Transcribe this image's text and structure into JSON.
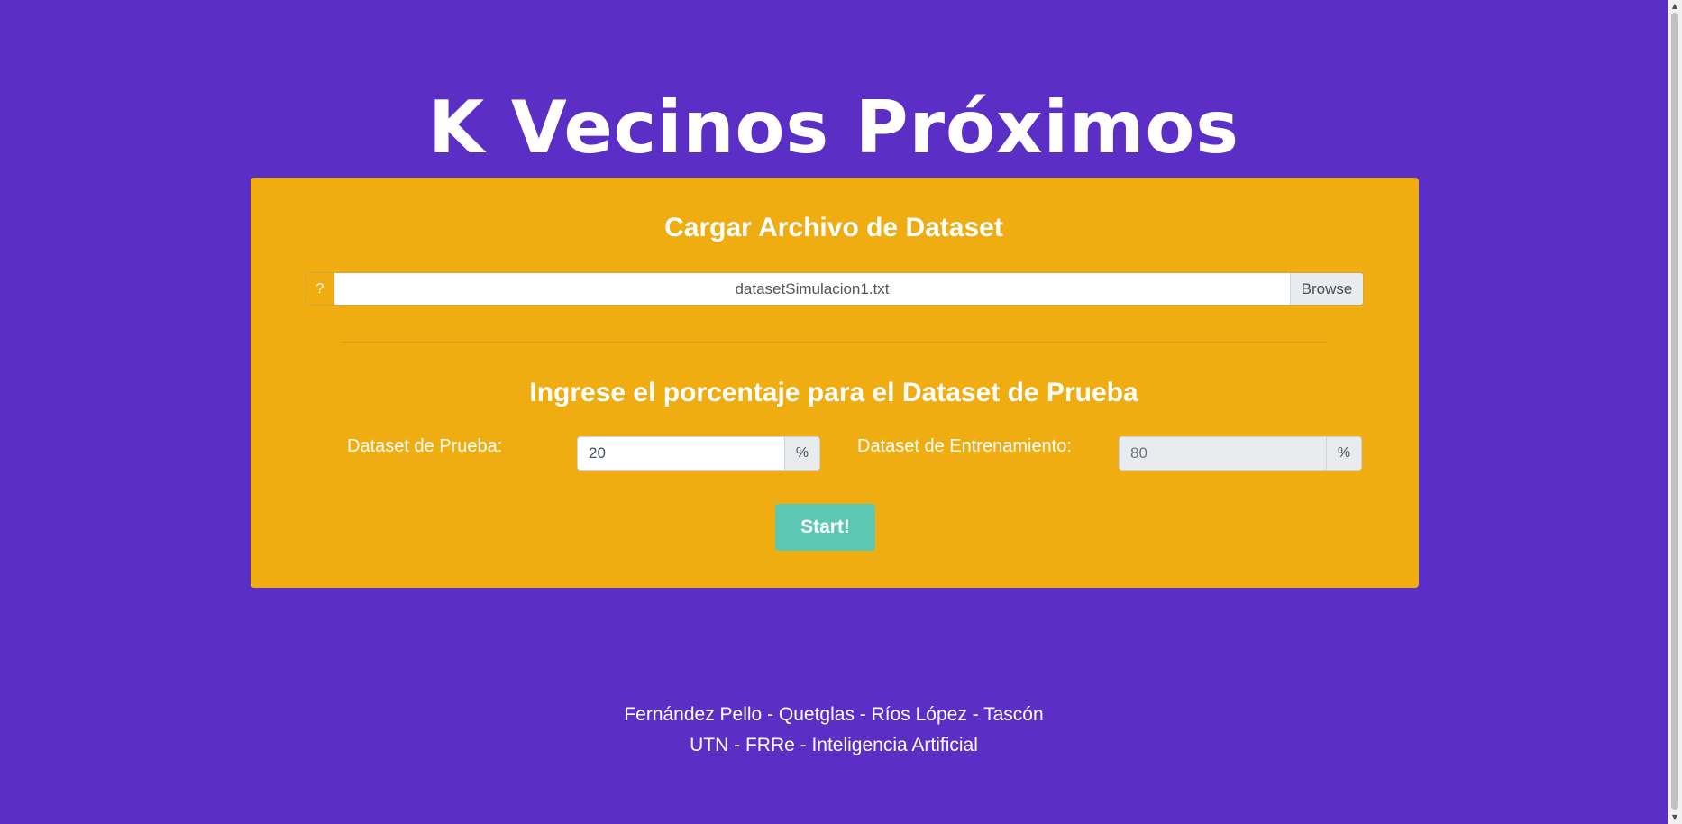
{
  "header": {
    "title": "K Vecinos Próximos"
  },
  "upload": {
    "title": "Cargar Archivo de Dataset",
    "help_label": "?",
    "file_name": "datasetSimulacion1.txt",
    "browse_label": "Browse"
  },
  "split": {
    "title": "Ingrese el porcentaje para el Dataset de Prueba",
    "test_label": "Dataset de Prueba:",
    "test_value": "20",
    "test_suffix": "%",
    "train_label": "Dataset de Entrenamiento:",
    "train_value": "80",
    "train_suffix": "%",
    "start_label": "Start!"
  },
  "footer": {
    "line1": "Fernández Pello - Quetglas - Ríos López - Tascón",
    "line2": "UTN - FRRe - Inteligencia Artificial"
  },
  "colors": {
    "background": "#5b2ec6",
    "card": "#f0ad12",
    "start_button": "#5cc7b2"
  },
  "icons": {
    "scroll_up": "chevron-up-icon",
    "scroll_down": "chevron-down-icon"
  }
}
